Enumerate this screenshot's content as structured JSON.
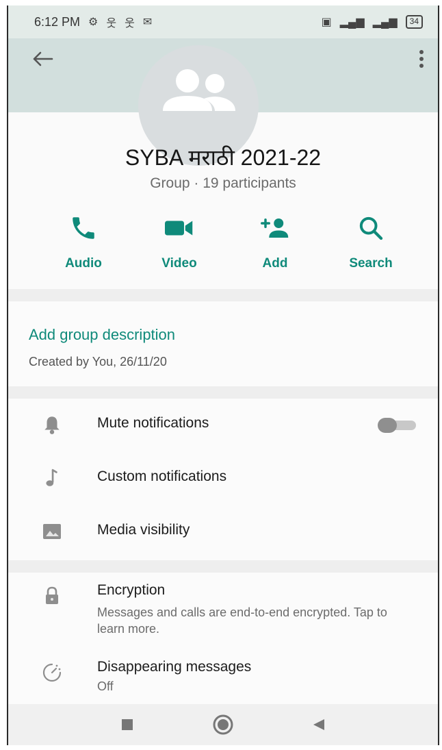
{
  "status_bar": {
    "time": "6:12 PM",
    "battery": "34"
  },
  "header": {
    "title": "SYBA मराठी 2021-22",
    "subtitle": "Group · 19 participants"
  },
  "actions": [
    {
      "label": "Audio",
      "icon": "phone-icon"
    },
    {
      "label": "Video",
      "icon": "video-icon"
    },
    {
      "label": "Add",
      "icon": "add-person-icon"
    },
    {
      "label": "Search",
      "icon": "search-icon"
    }
  ],
  "description": {
    "link": "Add group description",
    "created": "Created by You, 26/11/20"
  },
  "settings": {
    "mute": {
      "label": "Mute notifications",
      "enabled": false
    },
    "custom": {
      "label": "Custom notifications"
    },
    "media": {
      "label": "Media visibility"
    }
  },
  "security": {
    "encryption": {
      "label": "Encryption",
      "sub": "Messages and calls are end-to-end encrypted. Tap to learn more."
    },
    "disappearing": {
      "label": "Disappearing messages",
      "sub": "Off"
    }
  },
  "colors": {
    "accent": "#0f8a7a",
    "header_band": "#d2dfdd"
  }
}
